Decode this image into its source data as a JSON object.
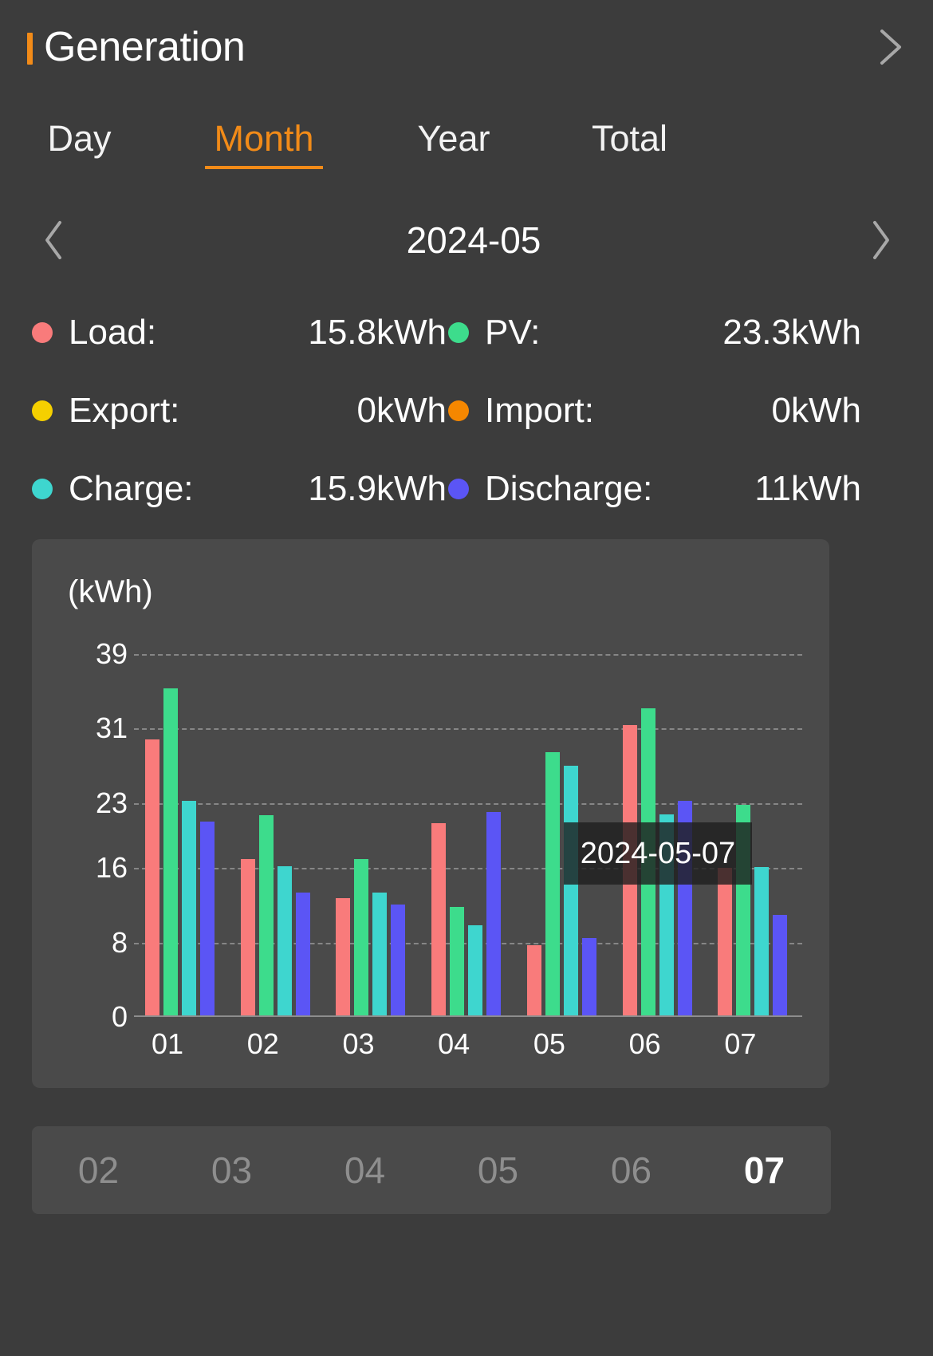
{
  "header": {
    "title": "Generation",
    "accent_color": "#f28b18",
    "chevron_icon": "chevron-right-icon"
  },
  "tabs": [
    {
      "label": "Day",
      "active": false
    },
    {
      "label": "Month",
      "active": true
    },
    {
      "label": "Year",
      "active": false
    },
    {
      "label": "Total",
      "active": false
    }
  ],
  "date_nav": {
    "prev_icon": "chevron-left-icon",
    "next_icon": "chevron-right-icon",
    "value": "2024-05"
  },
  "stats": [
    [
      {
        "label": "Load:",
        "value": "15.8kWh",
        "color": "#f97b7b"
      },
      {
        "label": "PV:",
        "value": "23.3kWh",
        "color": "#3ddc8c"
      }
    ],
    [
      {
        "label": "Export:",
        "value": "0kWh",
        "color": "#f5d000"
      },
      {
        "label": "Import:",
        "value": "0kWh",
        "color": "#f58700"
      }
    ],
    [
      {
        "label": "Charge:",
        "value": "15.9kWh",
        "color": "#3ed6cf"
      },
      {
        "label": "Discharge:",
        "value": "11kWh",
        "color": "#5b55f5"
      }
    ]
  ],
  "chart_data": {
    "type": "bar",
    "title": "",
    "unit_label": "(kWh)",
    "xlabel": "",
    "ylabel": "(kWh)",
    "ylim": [
      0,
      39
    ],
    "yticks": [
      0,
      8,
      16,
      23,
      31,
      39
    ],
    "grid": true,
    "legend_position": "top",
    "categories": [
      "01",
      "02",
      "03",
      "04",
      "05",
      "06",
      "07"
    ],
    "series": [
      {
        "name": "Load",
        "color": "#f97b7b",
        "values": [
          29.8,
          17.0,
          12.8,
          20.8,
          7.7,
          31.4,
          16.0
        ]
      },
      {
        "name": "PV",
        "color": "#3ddc8c",
        "values": [
          35.3,
          21.7,
          17.0,
          11.8,
          28.5,
          33.2,
          22.8
        ]
      },
      {
        "name": "Charge",
        "color": "#3ed6cf",
        "values": [
          23.2,
          16.2,
          13.4,
          9.9,
          27.0,
          21.8,
          16.1
        ]
      },
      {
        "name": "Discharge",
        "color": "#5b55f5",
        "values": [
          21.0,
          13.4,
          12.1,
          22.0,
          8.5,
          23.2,
          11.0
        ]
      }
    ],
    "annotations": [
      {
        "type": "tooltip",
        "text": "2024-05-07"
      }
    ]
  },
  "day_picker": {
    "items": [
      {
        "label": "02",
        "active": false
      },
      {
        "label": "03",
        "active": false
      },
      {
        "label": "04",
        "active": false
      },
      {
        "label": "05",
        "active": false
      },
      {
        "label": "06",
        "active": false
      },
      {
        "label": "07",
        "active": true
      }
    ]
  }
}
